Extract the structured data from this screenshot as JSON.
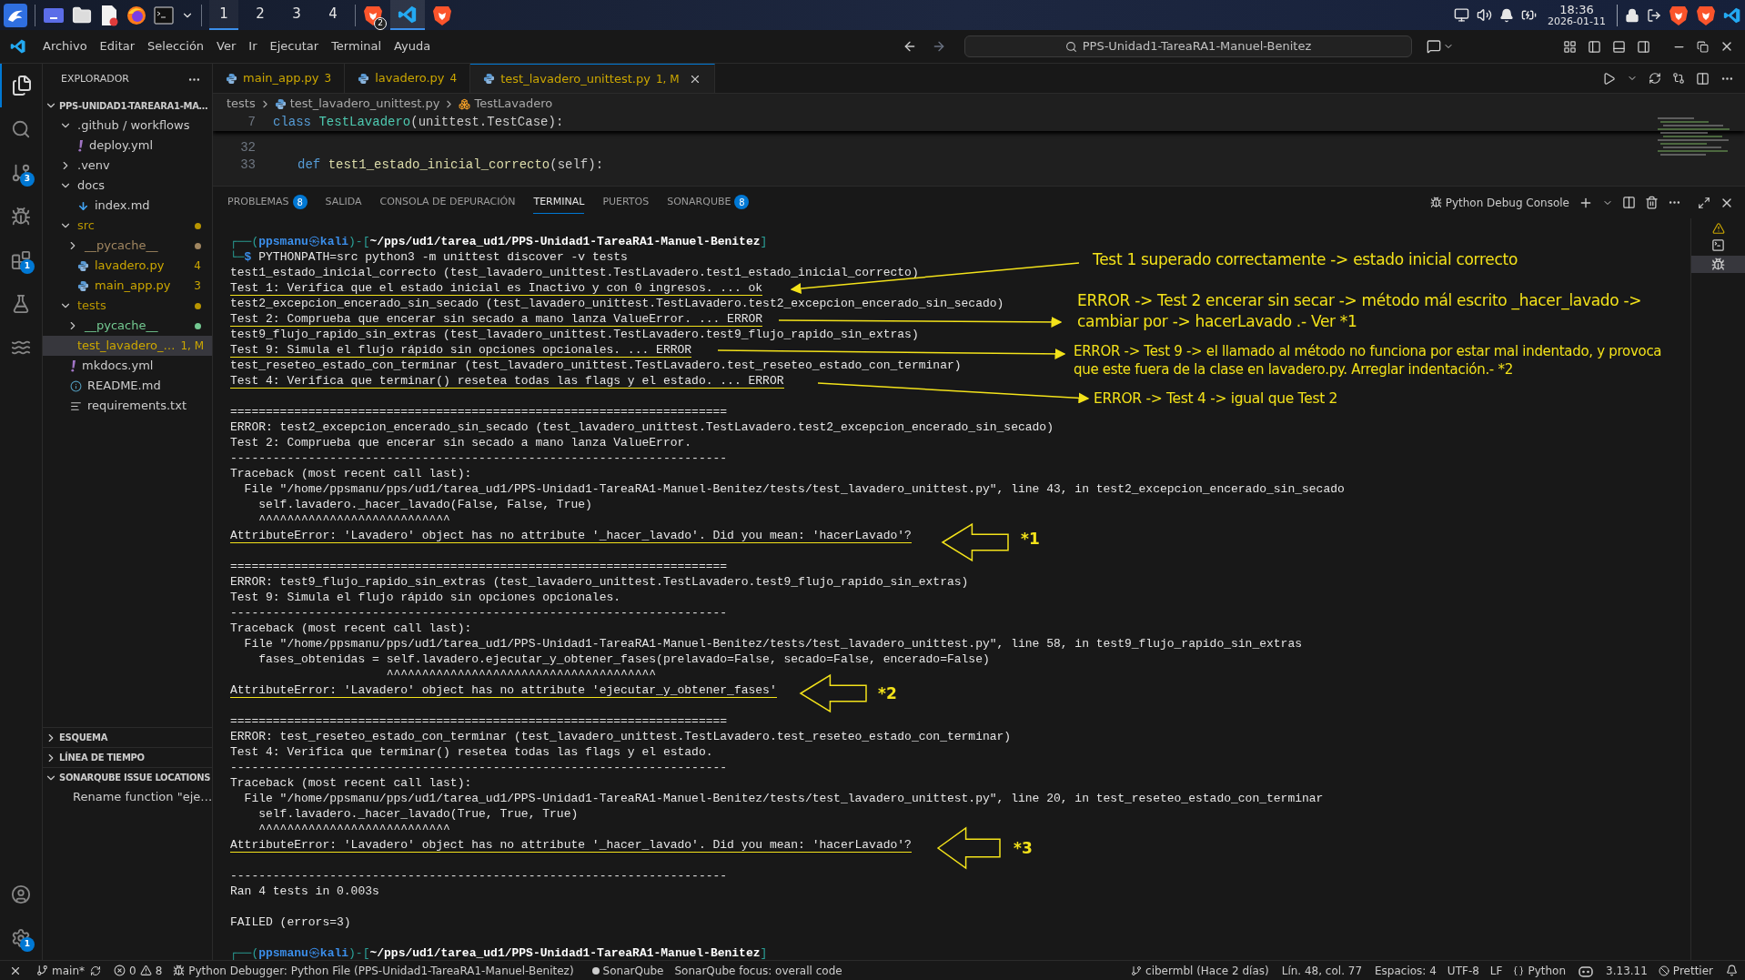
{
  "taskbar": {
    "workspaces": [
      {
        "label": "1",
        "selected": true
      },
      {
        "label": "2",
        "selected": false
      },
      {
        "label": "3",
        "selected": false
      },
      {
        "label": "4",
        "selected": false
      }
    ],
    "browser_badge": "2",
    "clock": {
      "time": "18:36",
      "date": "2026-01-11"
    }
  },
  "menu": {
    "items": [
      "Archivo",
      "Editar",
      "Selección",
      "Ver",
      "Ir",
      "Ejecutar",
      "Terminal",
      "Ayuda"
    ],
    "search": "PPS-Unidad1-TareaRA1-Manuel-Benitez"
  },
  "activity_bar": {
    "scm_badge": "3",
    "extensions_badge": "1",
    "settings_badge": "1"
  },
  "explorer": {
    "title": "EXPLORADOR",
    "root": "PPS-UNIDAD1-TAREARA1-MA…",
    "tree": [
      {
        "kind": "folder",
        "label": ".github / workflows",
        "expanded": true,
        "selected": false,
        "children": [
          {
            "kind": "yaml",
            "label": "deploy.yml",
            "selected": false
          }
        ]
      },
      {
        "kind": "folder",
        "label": ".venv",
        "expanded": false,
        "selected": false
      },
      {
        "kind": "folder",
        "label": "docs",
        "expanded": true,
        "selected": false,
        "children": [
          {
            "kind": "markdown",
            "label": "index.md",
            "selected": false
          }
        ]
      },
      {
        "kind": "folder",
        "label": "src",
        "expanded": true,
        "selected": false,
        "color": "#b89500",
        "children": [
          {
            "kind": "folder",
            "label": "__pycache__",
            "expanded": false,
            "selected": false,
            "color": "#a08660"
          },
          {
            "kind": "python",
            "label": "lavadero.py",
            "badge": "4",
            "selected": false,
            "color": "#cca700"
          },
          {
            "kind": "python",
            "label": "main_app.py",
            "badge": "3",
            "selected": false,
            "color": "#cca700"
          }
        ]
      },
      {
        "kind": "folder",
        "label": "tests",
        "expanded": true,
        "selected": false,
        "color": "#b89500",
        "children": [
          {
            "kind": "folder",
            "label": "__pycache__",
            "expanded": false,
            "selected": false,
            "color": "#73c991"
          },
          {
            "kind": "python",
            "label": "test_lavadero_…",
            "badge": "1, M",
            "selected": true,
            "color": "#cca700"
          }
        ]
      },
      {
        "kind": "yaml",
        "label": "mkdocs.yml",
        "selected": false
      },
      {
        "kind": "readme",
        "label": "README.md",
        "selected": false
      },
      {
        "kind": "text",
        "label": "requirements.txt",
        "selected": false
      }
    ],
    "sections": [
      {
        "label": "ESQUEMA",
        "expanded": false
      },
      {
        "label": "LÍNEA DE TIEMPO",
        "expanded": false
      },
      {
        "label": "SONARQUBE ISSUE LOCATIONS",
        "expanded": true,
        "items": [
          "Rename function \"eje…"
        ]
      }
    ]
  },
  "editor": {
    "tabs": [
      {
        "label": "main_app.py",
        "badge": "3",
        "selected": false
      },
      {
        "label": "lavadero.py",
        "badge": "4",
        "selected": false
      },
      {
        "label": "test_lavadero_unittest.py",
        "badge": "1, M",
        "selected": true
      }
    ],
    "breadcrumb": [
      "tests",
      "test_lavadero_unittest.py",
      "TestLavadero"
    ],
    "code": [
      {
        "number": "7",
        "kind": "class",
        "keyword": "class",
        "name": "TestLavadero",
        "rest": "(unittest.TestCase):"
      },
      {
        "number": "32",
        "kind": "blank"
      },
      {
        "number": "33",
        "kind": "def",
        "keyword": "def",
        "name": "test1_estado_inicial_correcto",
        "rest": "(self):"
      }
    ]
  },
  "panel": {
    "tabs": [
      {
        "label": "PROBLEMAS",
        "badge": "8",
        "selected": false
      },
      {
        "label": "SALIDA",
        "selected": false
      },
      {
        "label": "CONSOLA DE DEPURACIÓN",
        "selected": false
      },
      {
        "label": "TERMINAL",
        "selected": true
      },
      {
        "label": "PUERTOS",
        "selected": false
      },
      {
        "label": "SONARQUBE",
        "badge": "8",
        "selected": false
      }
    ],
    "terminal_name": "Python Debug Console"
  },
  "terminal": [
    {
      "kind": "prompt",
      "corner": "┌──(",
      "user": "ppsmanu",
      "at": "㉿",
      "host": "kali",
      "sep": ")-[",
      "path": "~/pps/ud1/tarea_ud1/PPS-Unidad1-TareaRA1-Manuel-Benitez",
      "end": "]"
    },
    {
      "kind": "command",
      "corner": "└─",
      "dollar": "$",
      "text": "PYTHONPATH=src python3 -m unittest discover -v tests"
    },
    {
      "kind": "output",
      "marked": false,
      "text": "test1_estado_inicial_correcto (test_lavadero_unittest.TestLavadero.test1_estado_inicial_correcto)"
    },
    {
      "kind": "output",
      "marked": true,
      "text": "Test 1: Verifica que el estado inicial es Inactivo y con 0 ingresos. ... ok"
    },
    {
      "kind": "output",
      "marked": false,
      "text": "test2_excepcion_encerado_sin_secado (test_lavadero_unittest.TestLavadero.test2_excepcion_encerado_sin_secado)"
    },
    {
      "kind": "output",
      "marked": true,
      "text": "Test 2: Comprueba que encerar sin secado a mano lanza ValueError. ... ERROR"
    },
    {
      "kind": "output",
      "marked": false,
      "text": "test9_flujo_rapido_sin_extras (test_lavadero_unittest.TestLavadero.test9_flujo_rapido_sin_extras)"
    },
    {
      "kind": "output",
      "marked": true,
      "text": "Test 9: Simula el flujo rápido sin opciones opcionales. ... ERROR"
    },
    {
      "kind": "output",
      "marked": false,
      "text": "test_reseteo_estado_con_terminar (test_lavadero_unittest.TestLavadero.test_reseteo_estado_con_terminar)"
    },
    {
      "kind": "output",
      "marked": true,
      "text": "Test 4: Verifica que terminar() resetea todas las flags y el estado. ... ERROR"
    },
    {
      "kind": "blank"
    },
    {
      "kind": "output",
      "marked": false,
      "text": "======================================================================"
    },
    {
      "kind": "output",
      "marked": false,
      "text": "ERROR: test2_excepcion_encerado_sin_secado (test_lavadero_unittest.TestLavadero.test2_excepcion_encerado_sin_secado)"
    },
    {
      "kind": "output",
      "marked": false,
      "text": "Test 2: Comprueba que encerar sin secado a mano lanza ValueError."
    },
    {
      "kind": "output",
      "marked": false,
      "text": "----------------------------------------------------------------------"
    },
    {
      "kind": "output",
      "marked": false,
      "text": "Traceback (most recent call last):"
    },
    {
      "kind": "output",
      "marked": false,
      "text": "  File \"/home/ppsmanu/pps/ud1/tarea_ud1/PPS-Unidad1-TareaRA1-Manuel-Benitez/tests/test_lavadero_unittest.py\", line 43, in test2_excepcion_encerado_sin_secado"
    },
    {
      "kind": "output",
      "marked": false,
      "text": "    self.lavadero._hacer_lavado(False, False, True)"
    },
    {
      "kind": "output",
      "marked": false,
      "text": "    ^^^^^^^^^^^^^^^^^^^^^^^^^^^"
    },
    {
      "kind": "output",
      "marked": true,
      "text": "AttributeError: 'Lavadero' object has no attribute '_hacer_lavado'. Did you mean: 'hacerLavado'?"
    },
    {
      "kind": "blank"
    },
    {
      "kind": "output",
      "marked": false,
      "text": "======================================================================"
    },
    {
      "kind": "output",
      "marked": false,
      "text": "ERROR: test9_flujo_rapido_sin_extras (test_lavadero_unittest.TestLavadero.test9_flujo_rapido_sin_extras)"
    },
    {
      "kind": "output",
      "marked": false,
      "text": "Test 9: Simula el flujo rápido sin opciones opcionales."
    },
    {
      "kind": "output",
      "marked": false,
      "text": "----------------------------------------------------------------------"
    },
    {
      "kind": "output",
      "marked": false,
      "text": "Traceback (most recent call last):"
    },
    {
      "kind": "output",
      "marked": false,
      "text": "  File \"/home/ppsmanu/pps/ud1/tarea_ud1/PPS-Unidad1-TareaRA1-Manuel-Benitez/tests/test_lavadero_unittest.py\", line 58, in test9_flujo_rapido_sin_extras"
    },
    {
      "kind": "output",
      "marked": false,
      "text": "    fases_obtenidas = self.lavadero.ejecutar_y_obtener_fases(prelavado=False, secado=False, encerado=False)"
    },
    {
      "kind": "output",
      "marked": false,
      "text": "                      ^^^^^^^^^^^^^^^^^^^^^^^^^^^^^^^^^^^^^^"
    },
    {
      "kind": "output",
      "marked": true,
      "text": "AttributeError: 'Lavadero' object has no attribute 'ejecutar_y_obtener_fases'"
    },
    {
      "kind": "blank"
    },
    {
      "kind": "output",
      "marked": false,
      "text": "======================================================================"
    },
    {
      "kind": "output",
      "marked": false,
      "text": "ERROR: test_reseteo_estado_con_terminar (test_lavadero_unittest.TestLavadero.test_reseteo_estado_con_terminar)"
    },
    {
      "kind": "output",
      "marked": false,
      "text": "Test 4: Verifica que terminar() resetea todas las flags y el estado."
    },
    {
      "kind": "output",
      "marked": false,
      "text": "----------------------------------------------------------------------"
    },
    {
      "kind": "output",
      "marked": false,
      "text": "Traceback (most recent call last):"
    },
    {
      "kind": "output",
      "marked": false,
      "text": "  File \"/home/ppsmanu/pps/ud1/tarea_ud1/PPS-Unidad1-TareaRA1-Manuel-Benitez/tests/test_lavadero_unittest.py\", line 20, in test_reseteo_estado_con_terminar"
    },
    {
      "kind": "output",
      "marked": false,
      "text": "    self.lavadero._hacer_lavado(True, True, True)"
    },
    {
      "kind": "output",
      "marked": false,
      "text": "    ^^^^^^^^^^^^^^^^^^^^^^^^^^^"
    },
    {
      "kind": "output",
      "marked": true,
      "text": "AttributeError: 'Lavadero' object has no attribute '_hacer_lavado'. Did you mean: 'hacerLavado'?"
    },
    {
      "kind": "blank"
    },
    {
      "kind": "output",
      "marked": false,
      "text": "----------------------------------------------------------------------"
    },
    {
      "kind": "output",
      "marked": false,
      "text": "Ran 4 tests in 0.003s"
    },
    {
      "kind": "blank"
    },
    {
      "kind": "output",
      "marked": false,
      "text": "FAILED (errors=3)"
    },
    {
      "kind": "blank"
    },
    {
      "kind": "prompt",
      "corner": "┌──(",
      "user": "ppsmanu",
      "at": "㉿",
      "host": "kali",
      "sep": ")-[",
      "path": "~/pps/ud1/tarea_ud1/PPS-Unidad1-TareaRA1-Manuel-Benitez",
      "end": "]"
    }
  ],
  "annotations": [
    {
      "lines": [
        "Test 1 superado correctamente -> estado inicial correcto"
      ]
    },
    {
      "lines": [
        "ERROR -> Test 2 encerar sin secar -> método mál escrito _hacer_lavado ->",
        "cambiar por -> hacerLavado .- Ver *1"
      ]
    },
    {
      "lines": [
        "ERROR -> Test 9 -> el llamado al método no funciona por estar mal indentado, y provoca",
        "que este fuera de la clase en lavadero.py. Arreglar indentación.- *2"
      ]
    },
    {
      "lines": [
        "ERROR -> Test 4 -> igual que Test 2"
      ]
    }
  ],
  "callouts": [
    {
      "label": "*1"
    },
    {
      "label": "*2"
    },
    {
      "label": "*3"
    }
  ],
  "status_bar": {
    "branch": "main*",
    "errors": "0",
    "warnings": "8",
    "debugger": "Python Debugger: Python File (PPS-Unidad1-TareaRA1-Manuel-Benitez)",
    "sonar": "SonarQube",
    "sonar_focus": "SonarQube focus: overall code",
    "blame": "cibermbl (Hace 2 días)",
    "position": "Lín. 48, col. 77",
    "indent": "Espacios: 4",
    "encoding": "UTF-8",
    "eol": "LF",
    "language": "Python",
    "version": "3.13.11",
    "formatter": "Prettier"
  }
}
